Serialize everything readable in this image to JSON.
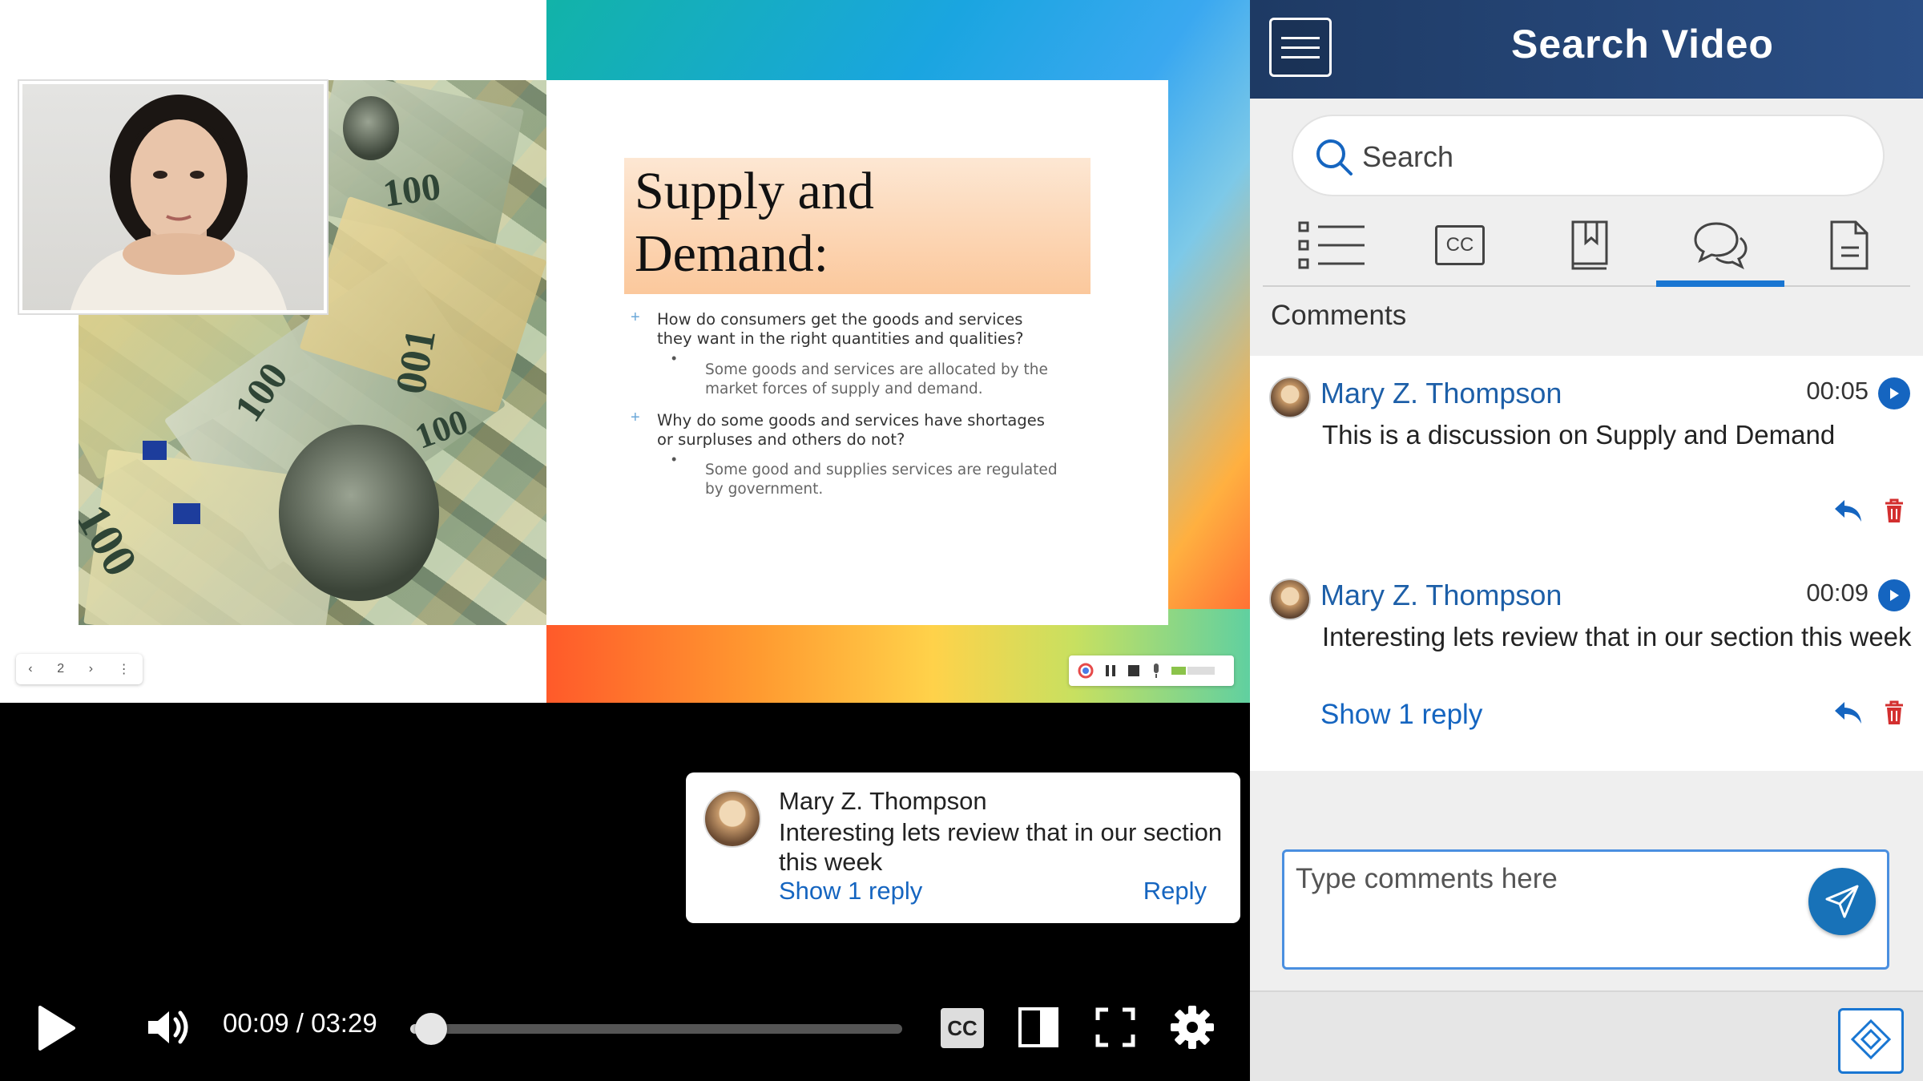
{
  "slide": {
    "title": "Supply and Demand:",
    "bullets": [
      {
        "level": 1,
        "text": "How do consumers get the goods and services they want in the right quantities and qualities?"
      },
      {
        "level": 2,
        "text": "Some goods and services are allocated by the market forces of supply and demand."
      },
      {
        "level": 1,
        "text": "Why do some goods and services have shortages or surpluses and others do not?"
      },
      {
        "level": 2,
        "text": "Some good and supplies services are regulated by government."
      }
    ],
    "nav": {
      "prev_icon": "chevron-left-icon",
      "page": "2",
      "next_icon": "chevron-right-icon",
      "more_icon": "more-vertical-icon"
    }
  },
  "popup": {
    "name": "Mary Z. Thompson",
    "text": "Interesting lets review that in our section this week",
    "show_reply": "Show 1 reply",
    "reply": "Reply"
  },
  "player": {
    "time": "00:09 / 03:29",
    "progress": 0.043,
    "cc": "CC"
  },
  "panel": {
    "title": "Search Video",
    "search_placeholder": "Search",
    "tabs": [
      {
        "icon": "list-icon"
      },
      {
        "icon": "cc-icon",
        "label": "CC"
      },
      {
        "icon": "bookmark-icon"
      },
      {
        "icon": "comments-icon",
        "active": true
      },
      {
        "icon": "document-icon"
      }
    ],
    "section_heading": "Comments",
    "comments": [
      {
        "name": "Mary Z. Thompson",
        "time": "00:05",
        "text": "This is a discussion on Supply and Demand"
      },
      {
        "name": "Mary Z. Thompson",
        "time": "00:09",
        "text": "Interesting lets review that in our section this week",
        "show_reply": "Show 1 reply"
      }
    ],
    "compose_placeholder": "Type comments here"
  },
  "colors": {
    "header": "#1e3a64",
    "link": "#1565c0",
    "accent": "#1976d2",
    "delete": "#d32f2f"
  }
}
